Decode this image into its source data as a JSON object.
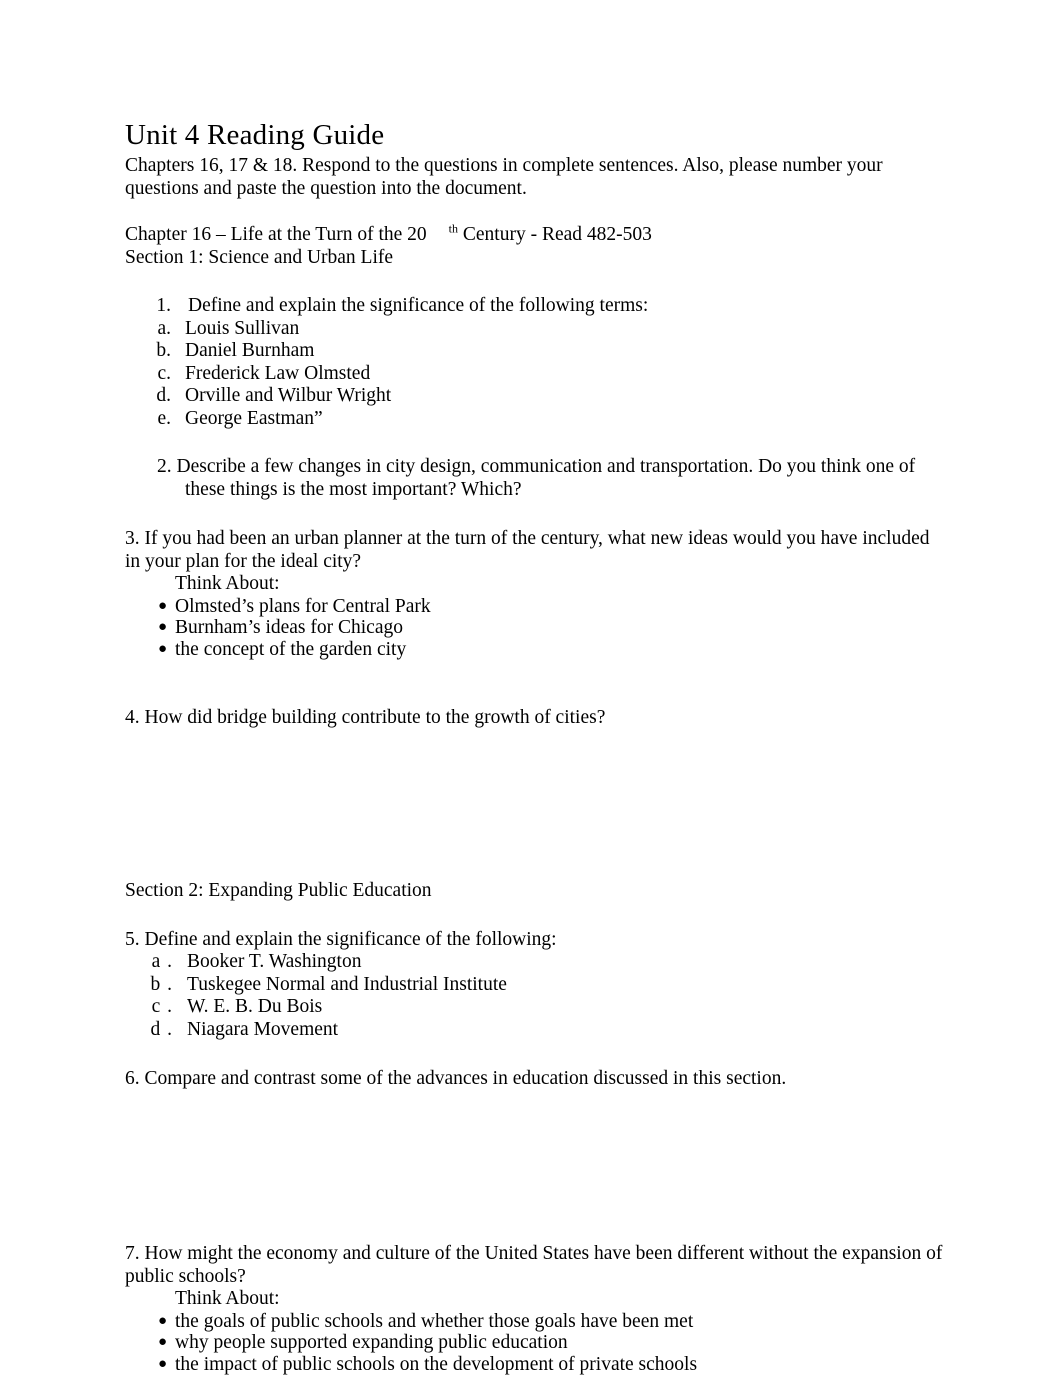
{
  "document": {
    "title": "Unit 4 Reading Guide",
    "intro": "Chapters 16, 17 & 18. Respond to the questions in complete sentences. Also, please number your questions and paste the question into the document.",
    "chapter_heading_before": "Chapter 16 – Life at the Turn of the 20",
    "chapter_heading_sup": "th",
    "chapter_heading_after": "Century - Read 482-503",
    "section1_heading": "Section 1: Science and Urban Life",
    "section2_heading": "Section 2: Expanding Public Education"
  },
  "section1": {
    "q1": {
      "marker": "1.",
      "text": "Define and explain the significance of the following terms:",
      "items": [
        {
          "marker": "a.",
          "text": "Louis Sullivan"
        },
        {
          "marker": "b.",
          "text": "Daniel Burnham"
        },
        {
          "marker": "c.",
          "text": "Frederick Law Olmsted"
        },
        {
          "marker": "d.",
          "text": "Orville and Wilbur Wright"
        },
        {
          "marker": "e.",
          "text": "George Eastman”"
        }
      ]
    },
    "q2": {
      "line1": "2. Describe a few changes in city design, communication and transportation. Do you think one of",
      "line2": "these things is the most important? Which?"
    },
    "q3": {
      "text": "3. If you had been an urban planner at the turn of the century, what new ideas would you have included in your plan for the ideal city?",
      "think_about": "Think About:",
      "bullets": [
        "Olmsted’s plans for Central Park",
        "Burnham’s ideas for Chicago",
        "the concept of the garden city"
      ]
    },
    "q4": {
      "text": "4. How did bridge building contribute to the growth of cities?"
    }
  },
  "section2": {
    "q5": {
      "text": "5. Define and explain the significance of the following:",
      "items": [
        {
          "marker": "a .",
          "text": "Booker T. Washington"
        },
        {
          "marker": "b .",
          "text": "Tuskegee Normal and Industrial Institute"
        },
        {
          "marker": "c .",
          "text": "W. E. B. Du Bois"
        },
        {
          "marker": "d .",
          "text": "Niagara Movement"
        }
      ]
    },
    "q6": {
      "text": "6. Compare and contrast some of the advances in education discussed in this section."
    },
    "q7": {
      "text": "7. How might the economy and culture of the United States have been different without the expansion of public schools?",
      "think_about": "Think About:",
      "bullets": [
        "the goals of public schools and whether those goals have been met",
        "why people supported expanding public education",
        "the impact of public schools on the development of private schools"
      ]
    }
  },
  "glyphs": {
    "bullet": "●"
  }
}
